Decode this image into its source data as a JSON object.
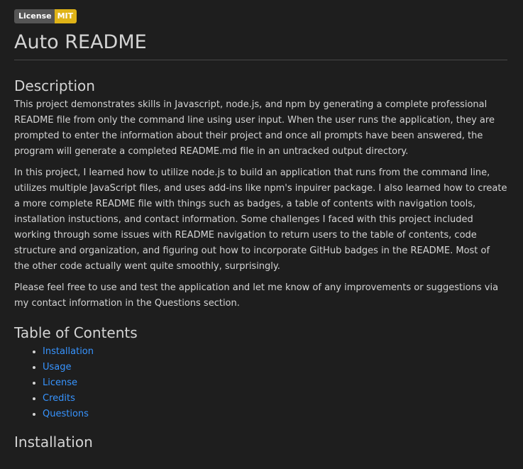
{
  "badge": {
    "label": "License",
    "value": "MIT",
    "label_color": "#555555",
    "value_color": "#dfb317"
  },
  "title": "Auto README",
  "description": {
    "heading": "Description",
    "paragraphs": [
      "This project demonstrates skills in Javascript, node.js, and npm by generating a complete professional README file from only the command line using user input. When the user runs the application, they are prompted to enter the information about their project and once all prompts have been answered, the program will generate a completed README.md file in an untracked output directory.",
      "In this project, I learned how to utilize node.js to build an application that runs from the command line, utilizes multiple JavaScript files, and uses add-ins like npm's inpuirer package. I also learned how to create a more complete README file with things such as badges, a table of contents with navigation tools, installation instuctions, and contact information. Some challenges I faced with this project included working through some issues with README navigation to return users to the table of contents, code structure and organization, and figuring out how to incorporate GitHub badges in the README. Most of the other code actually went quite smoothly, surprisingly.",
      "Please feel free to use and test the application and let me know of any improvements or suggestions via my contact information in the Questions section."
    ]
  },
  "toc": {
    "heading": "Table of Contents",
    "items": [
      "Installation",
      "Usage",
      "License",
      "Credits",
      "Questions"
    ]
  },
  "installation": {
    "heading": "Installation"
  },
  "colors": {
    "background": "#1e1e1e",
    "text": "#d4d4d4",
    "link": "#3794ff",
    "divider": "#474747"
  }
}
